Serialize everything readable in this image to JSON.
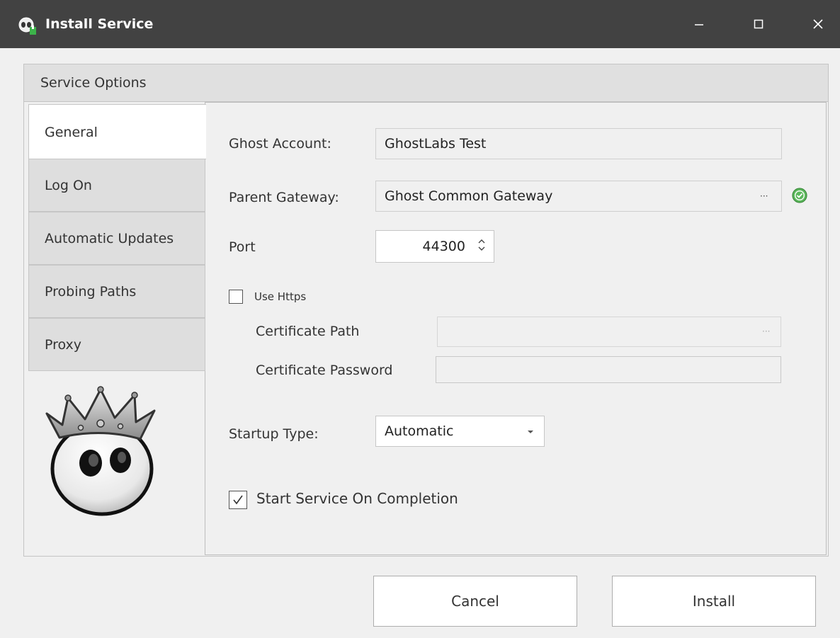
{
  "window": {
    "title": "Install Service"
  },
  "group": {
    "header": "Service Options"
  },
  "tabs": [
    {
      "label": "General",
      "active": true
    },
    {
      "label": "Log On"
    },
    {
      "label": "Automatic Updates"
    },
    {
      "label": "Probing Paths"
    },
    {
      "label": "Proxy"
    }
  ],
  "form": {
    "ghost_account_label": "Ghost Account:",
    "ghost_account_value": "GhostLabs Test",
    "parent_gateway_label": "Parent Gateway:",
    "parent_gateway_value": "Ghost Common Gateway",
    "browse_glyph": "···",
    "port_label": "Port",
    "port_value": "44300",
    "use_https_label": "Use Https",
    "use_https_checked": false,
    "cert_path_label": "Certificate Path",
    "cert_path_value": "",
    "cert_password_label": "Certificate Password",
    "cert_password_value": "",
    "startup_type_label": "Startup Type:",
    "startup_type_value": "Automatic",
    "start_on_completion_label": "Start Service On Completion",
    "start_on_completion_checked": true
  },
  "buttons": {
    "cancel": "Cancel",
    "install": "Install"
  },
  "colors": {
    "titlebar": "#424242",
    "ok_green": "#5cb85c"
  },
  "icons": [
    "ghost-app-icon",
    "minimize-icon",
    "maximize-icon",
    "close-icon",
    "ellipsis-icon",
    "gateway-ok-icon",
    "spinner-up-icon",
    "spinner-down-icon",
    "dropdown-arrow-icon",
    "checkmark-icon",
    "ghost-king-mascot"
  ]
}
